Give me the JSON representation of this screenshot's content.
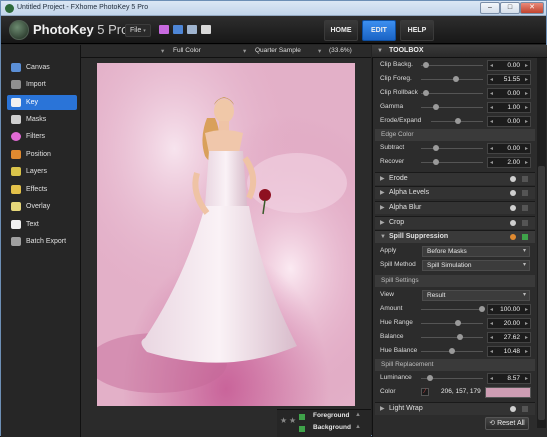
{
  "window": {
    "title": "Untitled Project - FXhome PhotoKey 5 Pro",
    "minimize": "–",
    "maximize": "□",
    "close": "✕"
  },
  "header": {
    "brand": "PhotoKey",
    "brand_version": "5 Pro",
    "file_menu": "File",
    "nav": {
      "home": "HOME",
      "edit": "EDIT",
      "help": "HELP"
    }
  },
  "sidebar": {
    "items": [
      {
        "label": "Canvas",
        "icon": "canvas-icon",
        "color": "#5b8fd6"
      },
      {
        "label": "Import",
        "icon": "import-icon",
        "color": "#8f8f8f"
      },
      {
        "label": "Key",
        "icon": "key-icon",
        "color": "#f0f0f0"
      },
      {
        "label": "Masks",
        "icon": "masks-icon",
        "color": "#cfcfcf"
      },
      {
        "label": "Filters",
        "icon": "filters-icon",
        "color": "#e06ad4"
      },
      {
        "label": "Position",
        "icon": "position-icon",
        "color": "#e08a30"
      },
      {
        "label": "Layers",
        "icon": "layers-icon",
        "color": "#d9c34a"
      },
      {
        "label": "Effects",
        "icon": "effects-icon",
        "color": "#e3c14a"
      },
      {
        "label": "Overlay",
        "icon": "overlay-icon",
        "color": "#e6d77a"
      },
      {
        "label": "Text",
        "icon": "text-icon",
        "color": "#f0f0f0"
      },
      {
        "label": "Batch Export",
        "icon": "batch-export-icon",
        "color": "#a0a0a0"
      }
    ]
  },
  "options_bar": {
    "color_mode": "Full Color",
    "quality": "Quarter Sample",
    "zoom": "(33.6%)"
  },
  "layers": {
    "foreground": "Foreground",
    "background": "Background"
  },
  "toolbox": {
    "title": "TOOLBOX",
    "rows_top": [
      {
        "label": "Clip Backg.",
        "value": "0.00"
      },
      {
        "label": "Clip Foreg.",
        "value": "51.55"
      },
      {
        "label": "Clip Rollback",
        "value": "0.00"
      },
      {
        "label": "Gamma",
        "value": "1.00"
      },
      {
        "label": "Erode/Expand",
        "value": "0.00"
      }
    ],
    "edge_color": {
      "heading": "Edge Color",
      "rows": [
        {
          "label": "Subtract",
          "value": "0.00"
        },
        {
          "label": "Recover",
          "value": "2.00"
        }
      ]
    },
    "collapsed_sections": [
      "Erode",
      "Alpha Levels",
      "Alpha Blur",
      "Crop"
    ],
    "spill": {
      "title": "Spill Suppression",
      "apply_label": "Apply",
      "apply_value": "Before Masks",
      "method_label": "Spill Method",
      "method_value": "Spill Simulation"
    },
    "spill_settings": {
      "heading": "Spill Settings",
      "view_label": "View",
      "view_value": "Result",
      "rows": [
        {
          "label": "Amount",
          "value": "100.00"
        },
        {
          "label": "Hue Range",
          "value": "20.00"
        },
        {
          "label": "Balance",
          "value": "27.62"
        },
        {
          "label": "Hue Balance",
          "value": "10.48"
        }
      ]
    },
    "spill_replacement": {
      "heading": "Spill Replacement",
      "luminance_label": "Luminance",
      "luminance_value": "8.57",
      "color_label": "Color",
      "color_value": "206, 157, 179",
      "swatch": "#ce9db3"
    },
    "light_wrap": "Light Wrap",
    "reset_all": "Reset All"
  },
  "colors": {
    "accent": "#2a74d8",
    "panel": "#2c2c2c"
  }
}
